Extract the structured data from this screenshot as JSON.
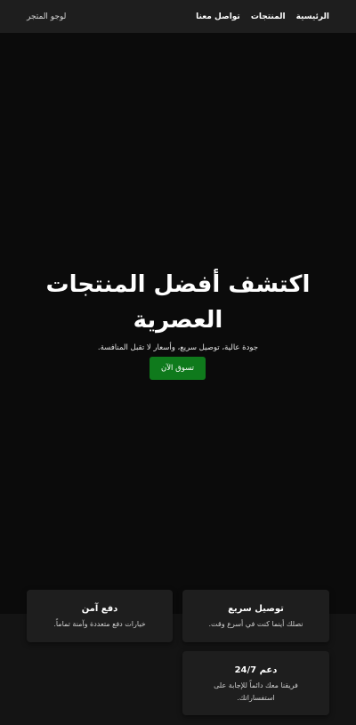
{
  "header": {
    "logo": "لوجو المتجر",
    "nav": [
      {
        "label": "الرئيسية"
      },
      {
        "label": "المنتجات"
      },
      {
        "label": "تواصل معنا"
      }
    ]
  },
  "hero": {
    "title": "اكتشف أفضل المنتجات العصرية",
    "subtitle": "جودة عالية، توصيل سريع، وأسعار لا تقبل المنافسة.",
    "cta_label": "تسوق الآن"
  },
  "features": [
    {
      "title": "توصيل سريع",
      "text": "نصلك أينما كنت في أسرع وقت."
    },
    {
      "title": "دفع آمن",
      "text": "خيارات دفع متعددة وآمنة تماماً."
    },
    {
      "title": "دعم 24/7",
      "text": "فريقنا معك دائماً للإجابة على استفساراتك."
    }
  ],
  "colors": {
    "background": "#0b0b0b",
    "header": "#1e1e1e",
    "card": "#1e1e1e",
    "accent": "#0f7a1c"
  }
}
